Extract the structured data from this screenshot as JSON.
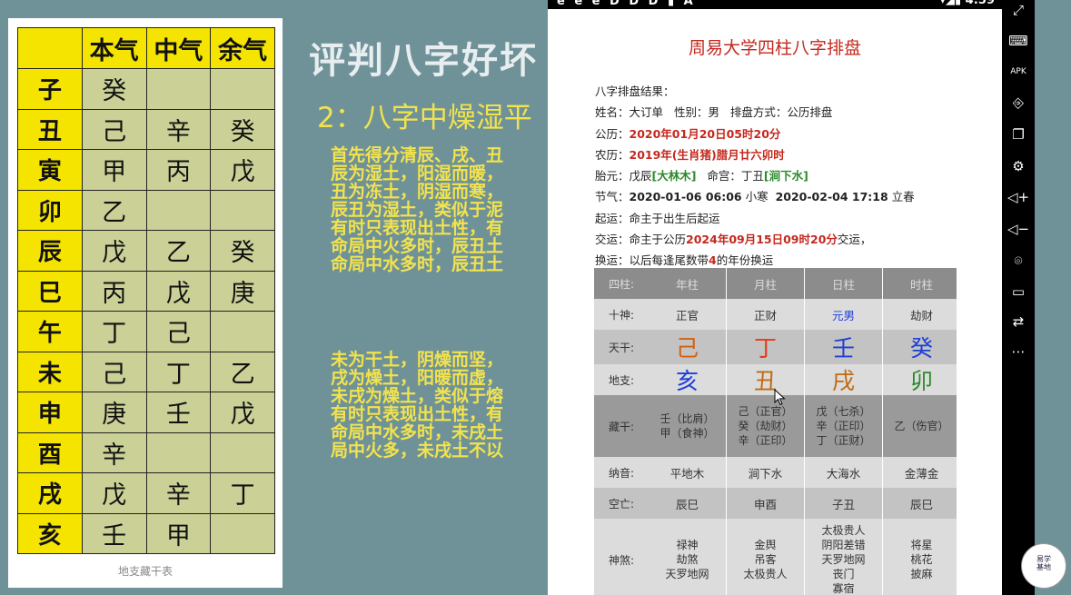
{
  "left": {
    "table": {
      "header": [
        "",
        "本气",
        "中气",
        "余气"
      ],
      "rows": [
        [
          "子",
          "癸",
          "",
          ""
        ],
        [
          "丑",
          "己",
          "辛",
          "癸"
        ],
        [
          "寅",
          "甲",
          "丙",
          "戊"
        ],
        [
          "卯",
          "乙",
          "",
          ""
        ],
        [
          "辰",
          "戊",
          "乙",
          "癸"
        ],
        [
          "巳",
          "丙",
          "戊",
          "庚"
        ],
        [
          "午",
          "丁",
          "己",
          ""
        ],
        [
          "未",
          "己",
          "丁",
          "乙"
        ],
        [
          "申",
          "庚",
          "壬",
          "戊"
        ],
        [
          "酉",
          "辛",
          "",
          ""
        ],
        [
          "戌",
          "戊",
          "辛",
          "丁"
        ],
        [
          "亥",
          "壬",
          "甲",
          ""
        ]
      ]
    },
    "caption": "地支藏干表"
  },
  "slide": {
    "title": "评判八字好坏",
    "subtitle": "2：八字中燥湿平",
    "para1": "首先得分清辰、戌、丑\n辰为湿土，阳湿而暖，\n丑为冻土，阴湿而寒，\n辰丑为湿土，类似于泥\n有时只表现出土性，有\n命局中火多时，辰丑土\n命局中水多时，辰丑土",
    "para2": "未为干土，阴燥而坚，\n戌为燥土，阳暖而虚，\n未戌为燥土，类似于熔\n有时只表现出土性，有\n命局中水多时，未戌土\n局中火多，未戌土不以"
  },
  "statusbar": {
    "left_icons": "e e e D D D ▮ A",
    "signal": "▾◢▮",
    "time": "4:59"
  },
  "app": {
    "title": "周易大学四柱八字排盘",
    "result_label": "八字排盘结果：",
    "name_line": {
      "label": "姓名：",
      "name": "大订单",
      "gender_label": "性别：",
      "gender": "男",
      "method_label": "排盘方式：",
      "method": "公历排盘"
    },
    "solar": {
      "label": "公历：",
      "value": "2020年01月20日05时20分"
    },
    "lunar": {
      "label": "农历：",
      "value": "2019年(生肖猪)腊月廿六卯时"
    },
    "taiyuan": {
      "label": "胎元：",
      "value": "戊辰",
      "nayin": "[大林木]",
      "minggong_label": "命宫：",
      "minggong": "丁丑",
      "minggong_nayin": "[涧下水]"
    },
    "jieqi": {
      "label": "节气：",
      "d1": "2020-01-06 06:06",
      "t1": "小寒",
      "d2": "2020-02-04 17:18",
      "t2": "立春"
    },
    "qiyun": {
      "label": "起运：",
      "value": "命主于出生后起运"
    },
    "jiaoyun": {
      "label": "交运：",
      "prefix": "命主于公历",
      "date": "2024年09月15日09时20分",
      "suffix": "交运，"
    },
    "huanyun": {
      "label": "换运：",
      "prefix": "以后每逢尾数带",
      "num": "4",
      "suffix": "的年份换运"
    },
    "chart": {
      "columns": [
        "四柱:",
        "年柱",
        "月柱",
        "日柱",
        "时柱"
      ],
      "shishen": {
        "label": "十神:",
        "values": [
          "正官",
          "正财",
          "元男",
          "劫财"
        ]
      },
      "tiangan": {
        "label": "天干:",
        "values": [
          "己",
          "丁",
          "壬",
          "癸"
        ],
        "colors": [
          "#d4600e",
          "#e23b1b",
          "#1f3fd8",
          "#1f3fd8"
        ]
      },
      "dizhi": {
        "label": "地支:",
        "values": [
          "亥",
          "丑",
          "戌",
          "卯"
        ],
        "colors": [
          "#1f3fd8",
          "#c06a10",
          "#c06a10",
          "#2c8a2c"
        ]
      },
      "canggan": {
        "label": "藏干:",
        "values": [
          "壬（比肩）\n甲（食神）",
          "己（正官）\n癸（劫财）\n辛（正印）",
          "戊（七杀）\n辛（正印）\n丁（正财）",
          "乙（伤官）"
        ]
      },
      "nayin": {
        "label": "纳音:",
        "values": [
          "平地木",
          "涧下水",
          "大海水",
          "金薄金"
        ]
      },
      "kongwang": {
        "label": "空亡:",
        "values": [
          "辰巳",
          "申酉",
          "子丑",
          "辰巳"
        ]
      },
      "shensha": {
        "label": "神煞:",
        "values": [
          "禄神\n劫煞\n天罗地网",
          "金舆\n吊客\n太极贵人",
          "太极贵人\n阴阳差错\n天罗地网\n丧门\n寡宿",
          "将星\n桃花\n披麻"
        ]
      }
    }
  },
  "navbar": {
    "icons": [
      "fullscreen-icon",
      "keyboard-icon",
      "apk-icon",
      "login-icon",
      "copy-icon",
      "settings-icon",
      "volume-up-icon",
      "volume-down-icon",
      "location-icon",
      "folder-icon",
      "rotate-icon",
      "more-icon"
    ],
    "apk_label": "APK",
    "more_label": "⋯"
  },
  "seal": {
    "text": "易学\n基地"
  }
}
